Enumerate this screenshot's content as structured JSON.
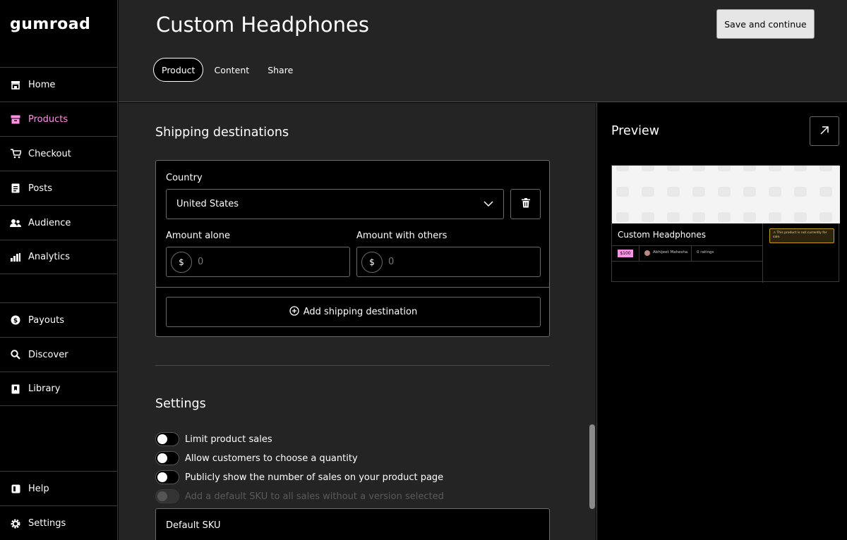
{
  "brand": {
    "logo_text": "GUMROAD"
  },
  "sidebar": {
    "items": [
      {
        "label": "Home",
        "icon": "store-icon"
      },
      {
        "label": "Products",
        "icon": "archive-icon",
        "active": true
      },
      {
        "label": "Checkout",
        "icon": "cart-icon"
      },
      {
        "label": "Posts",
        "icon": "document-icon"
      },
      {
        "label": "Audience",
        "icon": "people-icon"
      },
      {
        "label": "Analytics",
        "icon": "bar-chart-icon"
      },
      {
        "label": "Payouts",
        "icon": "dollar-circle-icon"
      },
      {
        "label": "Discover",
        "icon": "search-icon"
      },
      {
        "label": "Library",
        "icon": "bookmark-icon"
      },
      {
        "label": "Help",
        "icon": "book-icon"
      },
      {
        "label": "Settings",
        "icon": "gear-icon"
      }
    ]
  },
  "header": {
    "title": "Custom Headphones",
    "save_label": "Save and continue",
    "tabs": [
      {
        "label": "Product",
        "active": true
      },
      {
        "label": "Content"
      },
      {
        "label": "Share"
      }
    ]
  },
  "shipping": {
    "title": "Shipping destinations",
    "country_label": "Country",
    "country_value": "United States",
    "amount_alone_label": "Amount alone",
    "amount_with_others_label": "Amount with others",
    "currency_symbol": "$",
    "amount_alone_placeholder": "0",
    "amount_with_others_placeholder": "0",
    "add_label": "Add shipping destination"
  },
  "settings": {
    "title": "Settings",
    "toggles": [
      {
        "label": "Limit product sales",
        "on": false
      },
      {
        "label": "Allow customers to choose a quantity",
        "on": false
      },
      {
        "label": "Publicly show the number of sales on your product page",
        "on": false
      },
      {
        "label": "Add a default SKU to all sales without a version selected",
        "on": false,
        "disabled": true
      }
    ],
    "default_sku_label": "Default SKU"
  },
  "preview": {
    "title": "Preview",
    "product_name": "Custom Headphones",
    "price": "$100",
    "creator": "Abhijeet Mahesha",
    "ratings": "0 ratings",
    "warning": "This product is not currently for sale."
  },
  "colors": {
    "accent": "#ff90e8",
    "background": "#000000",
    "panel": "#242424"
  }
}
